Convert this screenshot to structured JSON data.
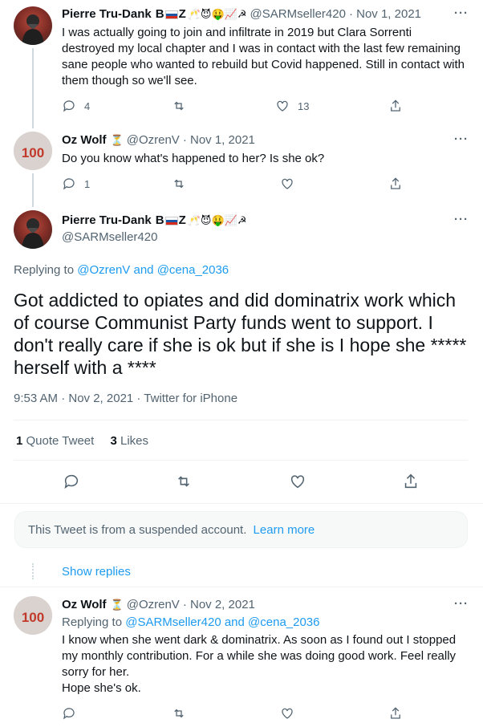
{
  "tweet1": {
    "name": "Pierre Tru-Dank",
    "name_suffix": "B",
    "name_z": "Z",
    "emoji": "🥂😈🤑📈☭",
    "handle": "@SARMseller420",
    "date": "· Nov 1, 2021",
    "text": "I was actually going to join and infiltrate in 2019 but Clara Sorrenti destroyed my local chapter and I was in contact with the last few remaining sane people who wanted to rebuild but Covid happened. Still in contact with them though so we'll see.",
    "replies": "4",
    "likes": "13"
  },
  "tweet2": {
    "name": "Oz Wolf",
    "emoji": "⏳",
    "handle": "@OzrenV",
    "date": "· Nov 1, 2021",
    "text": "Do you know what's happened to her? Is she ok?",
    "replies": "1",
    "avatar_text": "100"
  },
  "main": {
    "name": "Pierre Tru-Dank",
    "name_suffix": "B",
    "name_z": "Z",
    "emoji": "🥂😈🤑📈☭",
    "handle": "@SARMseller420",
    "replying_prefix": "Replying to",
    "replying_user1": "@OzrenV",
    "replying_and": "and",
    "replying_user2": "@cena_2036",
    "text": "Got addicted to opiates and did dominatrix work which of course Communist Party funds went to support. I don't really care if she is ok but if she is I hope she ***** herself with a ****",
    "timestamp": "9:53 AM · Nov 2, 2021 · Twitter for iPhone",
    "quote_count": "1",
    "quote_label": "Quote Tweet",
    "like_count": "3",
    "like_label": "Likes"
  },
  "suspended": {
    "text": "This Tweet is from a suspended account.",
    "link": "Learn more"
  },
  "show_replies": "Show replies",
  "tweet3": {
    "name": "Oz Wolf",
    "emoji": "⏳",
    "handle": "@OzrenV",
    "date": "· Nov 2, 2021",
    "replying_prefix": "Replying to",
    "replying_user1": "@SARMseller420",
    "replying_and": "and",
    "replying_user2": "@cena_2036",
    "text_line1": "I know when she went dark & dominatrix. As soon as I found out I stopped my monthly contribution. For a while she was doing good work. Feel really sorry for her.",
    "text_line2": "Hope she's ok.",
    "avatar_text": "100"
  },
  "more_glyph": "···"
}
